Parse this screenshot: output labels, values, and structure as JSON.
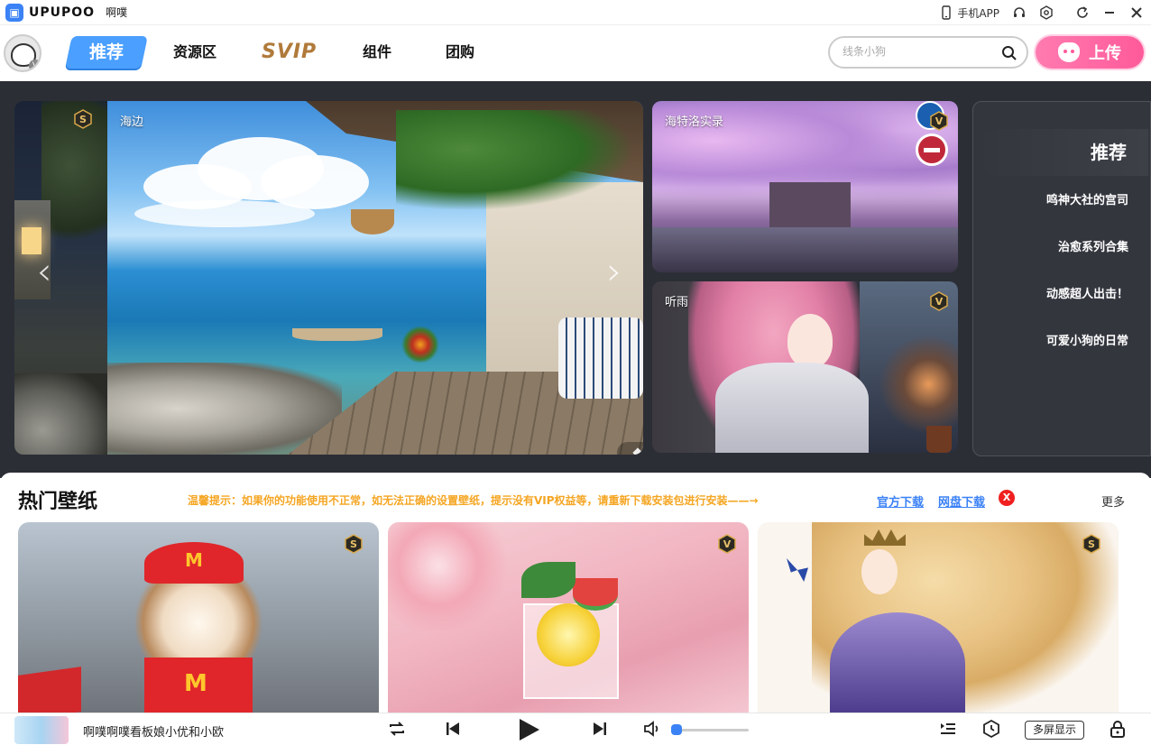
{
  "titlebar": {
    "app_name": "UPUPOO",
    "username": "啊噗",
    "mobile_app": "手机APP"
  },
  "nav": {
    "tabs": [
      {
        "label": "推荐"
      },
      {
        "label": "资源区"
      },
      {
        "label": "SVIP"
      },
      {
        "label": "组件"
      },
      {
        "label": "团购"
      }
    ],
    "search_placeholder": "线条小狗",
    "upload_label": "上传"
  },
  "banner": {
    "main_label": "海边",
    "top_right_label": "海特洛实录",
    "bottom_right_label": "听雨",
    "prev_arrow": "‹",
    "next_arrow": "›",
    "slide_count": 5,
    "recommend": {
      "title": "推荐",
      "items": [
        "鸣神大社的宫司",
        "治愈系列合集",
        "动感超人出击！",
        "可爱小狗的日常"
      ]
    }
  },
  "hot": {
    "title": "热门壁纸",
    "notice": "温馨提示：如果你的功能使用不正常，如无法正确的设置壁纸，提示没有VIP权益等，请重新下载安装包进行安装——→",
    "official_download": "官方下载",
    "cloud_download": "网盘下载",
    "close_label": "X",
    "more_label": "更多"
  },
  "player": {
    "title": "啊噗啊噗看板娘小优和小欧",
    "multi_screen": "多屏显示",
    "volume_level": 0.05
  },
  "colors": {
    "accent": "#4a9fff",
    "upload_pink": "#ff5a9a",
    "banner_bg": "#2c2e36",
    "notice_orange": "#f5a623",
    "link_blue": "#3b82f6",
    "svip_gold": "#b07a3a"
  }
}
